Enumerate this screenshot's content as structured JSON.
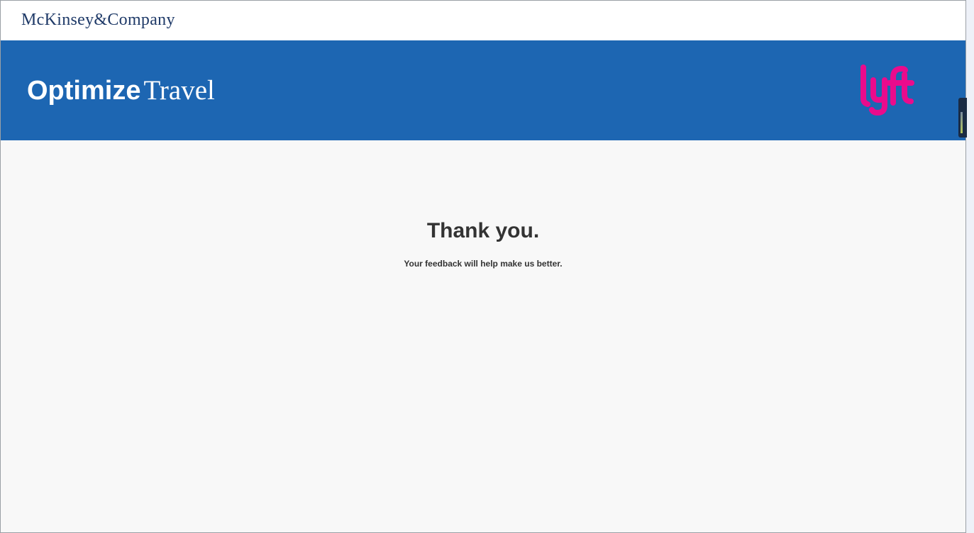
{
  "header": {
    "company_name": "McKinsey&Company"
  },
  "banner": {
    "title_bold": "Optimize",
    "title_light": "Travel",
    "partner_logo": "lyft"
  },
  "main": {
    "heading": "Thank you.",
    "message": "Your feedback will help make us better."
  },
  "colors": {
    "banner": "#1d66b2",
    "partner_logo": "#ea0b8c",
    "text": "#333333",
    "company": "#1f3a68"
  }
}
